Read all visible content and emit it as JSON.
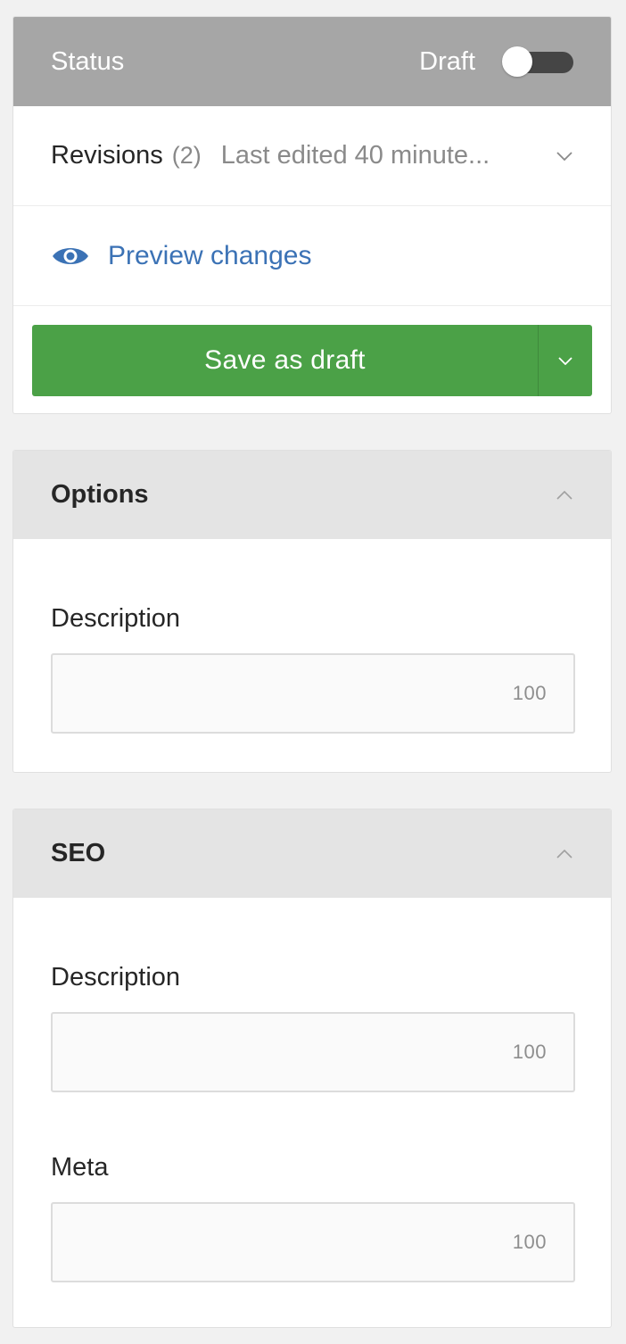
{
  "status_panel": {
    "title": "Status",
    "state_label": "Draft",
    "published_toggle_on": false,
    "revisions": {
      "label": "Revisions",
      "count": "(2)",
      "last_edited": "Last edited 40 minute..."
    },
    "preview_label": "Preview changes",
    "save_label": "Save as draft"
  },
  "options_panel": {
    "title": "Options",
    "fields": [
      {
        "label": "Description",
        "value": "",
        "char_limit": "100"
      }
    ]
  },
  "seo_panel": {
    "title": "SEO",
    "fields": [
      {
        "label": "Description",
        "value": "",
        "char_limit": "100"
      },
      {
        "label": "Meta",
        "value": "",
        "char_limit": "100"
      }
    ]
  },
  "colors": {
    "status_header_bg": "#a6a6a6",
    "section_header_bg": "#e4e4e4",
    "save_button": "#4ba147",
    "link": "#3b72b5",
    "page_bg": "#f1f1f1"
  },
  "icons": {
    "revisions_toggle": "chevron-down-icon",
    "preview": "eye-icon",
    "save_options": "chevron-down-icon",
    "collapse": "chevron-up-icon"
  }
}
